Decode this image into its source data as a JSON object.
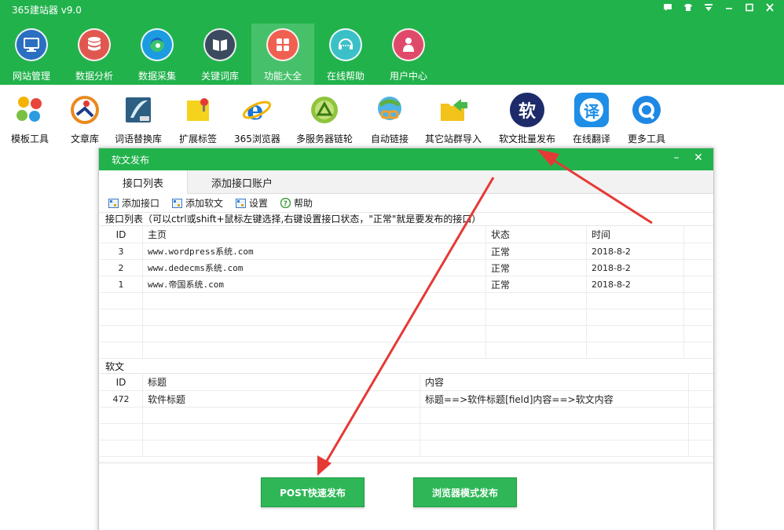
{
  "app": {
    "title": "365建站器 v9.0"
  },
  "window_controls": [
    "message-icon",
    "shirt-icon",
    "menu-icon",
    "minimize-icon",
    "maximize-icon",
    "close-icon"
  ],
  "nav": {
    "items": [
      {
        "label": "网站管理",
        "icon": "monitor-icon",
        "color": "#2a6fc0"
      },
      {
        "label": "数据分析",
        "icon": "database-icon",
        "color": "#e0574f"
      },
      {
        "label": "数据采集",
        "icon": "edge-icon",
        "color": "#1c9be0"
      },
      {
        "label": "关键词库",
        "icon": "book-icon",
        "color": "#3b4a5e"
      },
      {
        "label": "功能大全",
        "icon": "apps-icon",
        "color": "#f06050",
        "active": true
      },
      {
        "label": "在线帮助",
        "icon": "support-icon",
        "color": "#3cc0c8"
      },
      {
        "label": "用户中心",
        "icon": "user-icon",
        "color": "#e04a6a"
      }
    ]
  },
  "tools": [
    {
      "label": "模板工具",
      "icon": "template-icon"
    },
    {
      "label": "文章库",
      "icon": "article-icon"
    },
    {
      "label": "词语替换库",
      "icon": "word-replace-icon"
    },
    {
      "label": "扩展标签",
      "icon": "tag-icon"
    },
    {
      "label": "365浏览器",
      "icon": "browser-icon"
    },
    {
      "label": "多服务器链轮",
      "icon": "server-chain-icon"
    },
    {
      "label": "自动链接",
      "icon": "auto-link-icon"
    },
    {
      "label": "其它站群导入",
      "icon": "folder-import-icon"
    },
    {
      "label": "软文批量发布",
      "icon": "soft-article-icon",
      "glyph": "软"
    },
    {
      "label": "在线翻译",
      "icon": "translate-icon",
      "glyph": "译"
    },
    {
      "label": "更多工具",
      "icon": "more-tools-icon"
    }
  ],
  "dialog": {
    "title": "软文发布",
    "tabs": [
      {
        "label": "接口列表",
        "active": true
      },
      {
        "label": "添加接口账户"
      }
    ],
    "toolbar": [
      {
        "label": "添加接口",
        "icon": "add-api-icon"
      },
      {
        "label": "添加软文",
        "icon": "add-article-icon"
      },
      {
        "label": "设置",
        "icon": "settings-icon"
      },
      {
        "label": "帮助",
        "icon": "help-icon"
      }
    ],
    "api_list_label": "接口列表（可以ctrl或shift+鼠标左键选择,右键设置接口状态，\"正常\"就是要发布的接口）",
    "api_table": {
      "columns": [
        "ID",
        "主页",
        "状态",
        "时间"
      ],
      "rows": [
        [
          "3",
          "www.wordpress系统.com",
          "正常",
          "2018-8-2"
        ],
        [
          "2",
          "www.dedecms系统.com",
          "正常",
          "2018-8-2"
        ],
        [
          "1",
          "www.帝国系统.com",
          "正常",
          "2018-8-2"
        ]
      ]
    },
    "article_label": "软文",
    "article_table": {
      "columns": [
        "ID",
        "标题",
        "内容"
      ],
      "rows": [
        [
          "472",
          "软件标题",
          "标题==>软件标题[field]内容==>软文内容"
        ]
      ]
    },
    "buttons": {
      "post": "POST快速发布",
      "browser": "浏览器模式发布"
    }
  },
  "colors": {
    "brand_green": "#22b24c",
    "arrow_red": "#e53935"
  }
}
